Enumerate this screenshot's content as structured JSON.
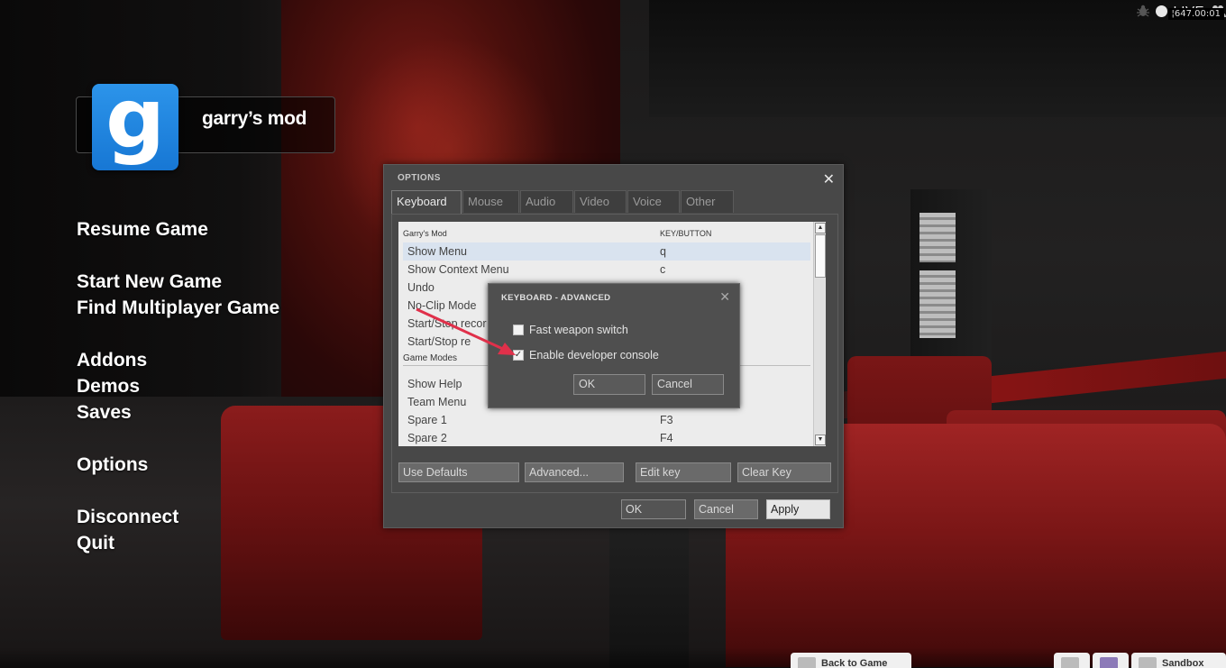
{
  "status": {
    "live_label": "LIVE",
    "fps_text": "¦647.00:01"
  },
  "logo": {
    "letter": "g",
    "text": "garry’s mod"
  },
  "menu": {
    "items": [
      "Resume Game",
      "Start New Game",
      "Find Multiplayer Game",
      "Addons",
      "Demos",
      "Saves",
      "Options",
      "Disconnect",
      "Quit"
    ]
  },
  "options": {
    "title": "OPTIONS",
    "close": "✕",
    "tabs": [
      "Keyboard",
      "Mouse",
      "Audio",
      "Video",
      "Voice",
      "Other"
    ],
    "list": {
      "header_group": "Garry's Mod",
      "header_key": "KEY/BUTTON",
      "rows": [
        {
          "name": "Show Menu",
          "key": "q"
        },
        {
          "name": "Show Context Menu",
          "key": "c"
        },
        {
          "name": "Undo",
          "key": ""
        },
        {
          "name": "No-Clip Mode",
          "key": ""
        },
        {
          "name": "Start/Stop recor",
          "key": ""
        },
        {
          "name": "Start/Stop re",
          "key": ""
        }
      ],
      "section2": "Game Modes",
      "rows2": [
        {
          "name": "Show Help",
          "key": ""
        },
        {
          "name": "Team Menu",
          "key": ""
        },
        {
          "name": "Spare 1",
          "key": "F3"
        },
        {
          "name": "Spare 2",
          "key": "F4"
        }
      ]
    },
    "buttons": {
      "use_defaults": "Use Defaults",
      "advanced": "Advanced...",
      "edit_key": "Edit key",
      "clear_key": "Clear Key",
      "ok": "OK",
      "cancel": "Cancel",
      "apply": "Apply"
    }
  },
  "advanced": {
    "title": "KEYBOARD - ADVANCED",
    "close": "✕",
    "options": [
      {
        "label": "Fast weapon switch",
        "checked": false
      },
      {
        "label": "Enable developer console",
        "checked": true
      }
    ],
    "checkmark": "✓",
    "ok": "OK",
    "cancel": "Cancel"
  },
  "bottom": {
    "back_to_game": "Back to Game",
    "sandbox": "Sandbox"
  },
  "colors": {
    "logo_blue": "#1f86e0",
    "annotation_arrow": "#e0304a"
  }
}
